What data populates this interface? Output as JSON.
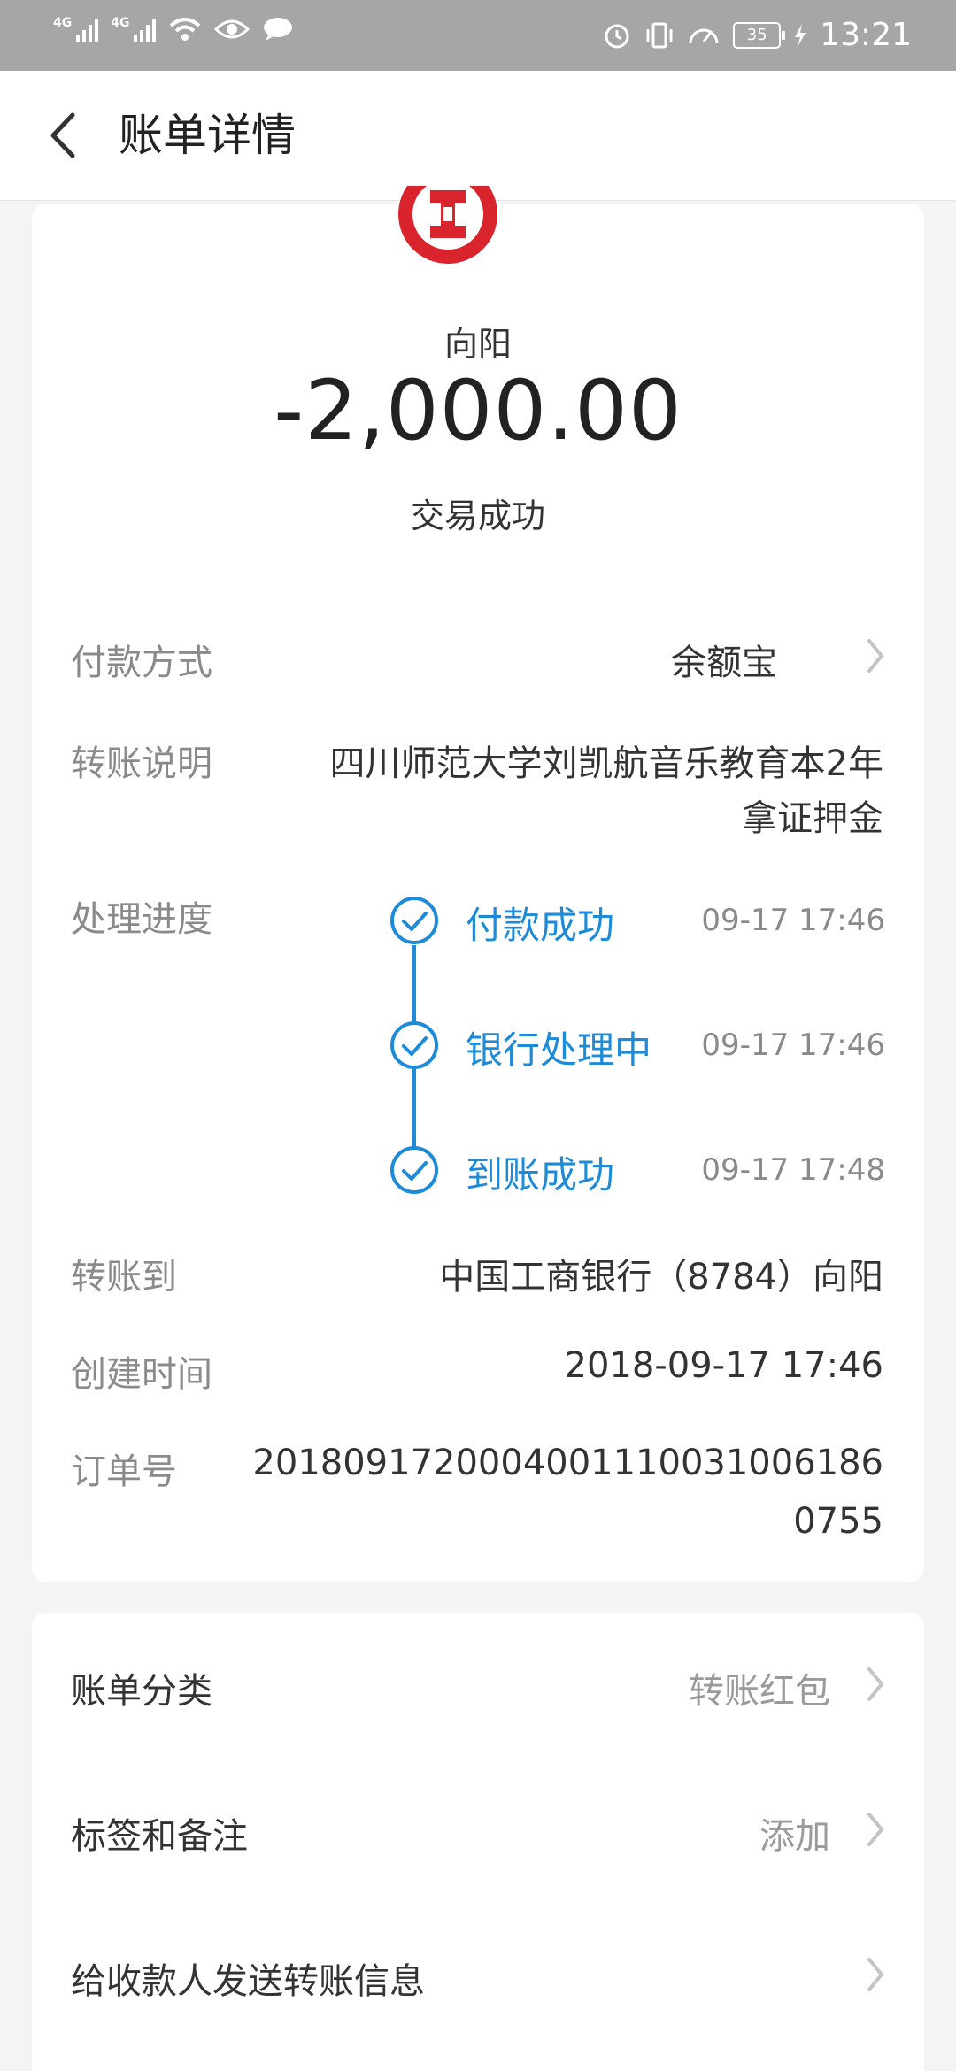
{
  "status_bar": {
    "signal1_tag": "4G",
    "signal2_tag": "4G",
    "battery": "35",
    "time": "13:21"
  },
  "header": {
    "title": "账单详情"
  },
  "summary": {
    "payee": "向阳",
    "amount": "-2,000.00",
    "status": "交易成功"
  },
  "details": {
    "payment_method_label": "付款方式",
    "payment_method_value": "余额宝",
    "transfer_note_label": "转账说明",
    "transfer_note_line1": "四川师范大学刘凯航音乐教育本2年",
    "transfer_note_line2": "拿证押金",
    "progress_label": "处理进度",
    "progress_steps": [
      {
        "label": "付款成功",
        "time": "09-17 17:46"
      },
      {
        "label": "银行处理中",
        "time": "09-17 17:46"
      },
      {
        "label": "到账成功",
        "time": "09-17 17:48"
      }
    ],
    "transfer_to_label": "转账到",
    "transfer_to_value": "中国工商银行（8784）向阳",
    "created_label": "创建时间",
    "created_value": "2018-09-17 17:46",
    "order_label": "订单号",
    "order_line1": "20180917200040011100310061​86",
    "order_line2": "0755"
  },
  "options": {
    "category_label": "账单分类",
    "category_value": "转账红包",
    "tags_label": "标签和备注",
    "tags_value": "添加",
    "send_label": "给收款人发送转账信息"
  },
  "colors": {
    "accent": "#1d8bd8",
    "bank_red": "#d9232d"
  }
}
